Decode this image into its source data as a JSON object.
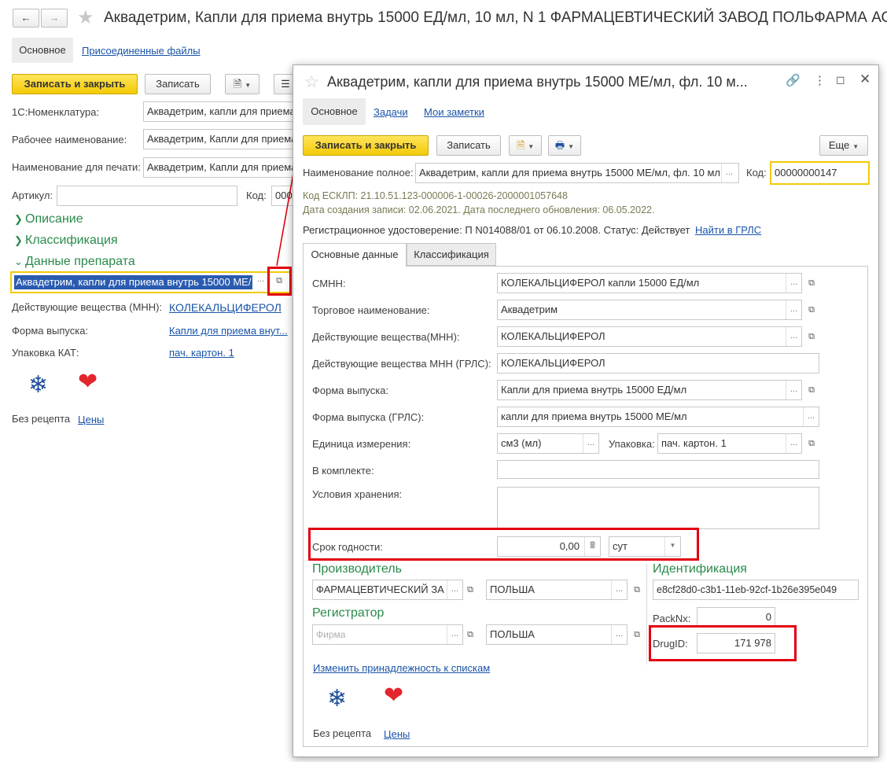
{
  "back": {
    "title": "Аквадетрим, Капли для приема внутрь 15000 ЕД/мл, 10 мл, N 1 ФАРМАЦЕВТИЧЕСКИЙ ЗАВОД ПОЛЬФАРМА АО",
    "tabs": [
      "Основное",
      "Присоединенные файлы"
    ],
    "toolbar": {
      "save_close": "Записать и закрыть",
      "save": "Записать"
    },
    "fields": {
      "nomenclature_label": "1С:Номенклатура:",
      "nomenclature_value": "Аквадетрим, капли для приема",
      "work_name_label": "Рабочее наименование:",
      "work_name_value": "Аквадетрим, Капли для приема",
      "print_name_label": "Наименование для печати:",
      "print_name_value": "Аквадетрим, Капли для приема",
      "article_label": "Артикул:",
      "article_value": "",
      "code_label": "Код:",
      "code_value": "000"
    },
    "groups": {
      "description": "Описание",
      "classification": "Классификация",
      "drug_data": "Данные препарата"
    },
    "drug_field": "Аквадетрим, капли для приема внутрь 15000 МЕ/",
    "substances_label": "Действующие вещества (МНН):",
    "substances_value": "КОЛЕКАЛЬЦИФЕРОЛ",
    "form_label": "Форма выпуска:",
    "form_value": "Капли для приема внут...",
    "pack_label": "Упаковка КАТ:",
    "pack_value": "пач. картон. 1",
    "no_rx": "Без рецепта",
    "prices": "Цены"
  },
  "dialog": {
    "title": "Аквадетрим, капли для приема внутрь 15000 МЕ/мл, фл. 10 м...",
    "tabs": [
      "Основное",
      "Задачи",
      "Мои заметки"
    ],
    "toolbar": {
      "save_close": "Записать и закрыть",
      "save": "Записать",
      "more": "Еще"
    },
    "full_name_label": "Наименование полное:",
    "full_name_value": "Аквадетрим, капли для приема внутрь 15000 МЕ/мл, фл. 10 мл",
    "code_label": "Код:",
    "code_value": "00000000147",
    "esklp": "Код ЕСКЛП: 21.10.51.123-000006-1-00026-2000001057648",
    "dates": "Дата создания записи: 02.06.2021. Дата последнего обновления: 06.05.2022.",
    "reg_cert": "Регистрационное удостоверение: П N014088/01 от 06.10.2008. Статус: Действует",
    "find_grls": "Найти в ГРЛС",
    "inner_tabs": [
      "Основные данные",
      "Классификация"
    ],
    "rows": {
      "smnn_label": "СМНН:",
      "smnn_value": "КОЛЕКАЛЬЦИФЕРОЛ капли 15000 ЕД/мл",
      "trade_label": "Торговое наименование:",
      "trade_value": "Аквадетрим",
      "subst_label": "Действующие вещества(МНН):",
      "subst_value": "КОЛЕКАЛЬЦИФЕРОЛ",
      "subst_grls_label": "Действующие вещества МНН (ГРЛС):",
      "subst_grls_value": "КОЛЕКАЛЬЦИФЕРОЛ",
      "form_label": "Форма выпуска:",
      "form_value": "Капли для приема внутрь 15000 ЕД/мл",
      "form_grls_label": "Форма выпуска (ГРЛС):",
      "form_grls_value": "капли для приема внутрь 15000 МЕ/мл",
      "unit_label": "Единица измерения:",
      "unit_value": "см3 (мл)",
      "pack_label": "Упаковка:",
      "pack_value": "пач. картон. 1",
      "kit_label": "В комплекте:",
      "storage_label": "Условия хранения:",
      "shelf_label": "Срок годности:",
      "shelf_value": "0,00",
      "shelf_unit": "сут"
    },
    "manufacturer": {
      "title": "Производитель",
      "name": "ФАРМАЦЕВТИЧЕСКИЙ ЗА",
      "country": "ПОЛЬША"
    },
    "registrar": {
      "title": "Регистратор",
      "placeholder": "Фирма",
      "country": "ПОЛЬША"
    },
    "identification": {
      "title": "Идентификация",
      "guid": "e8cf28d0-c3b1-11eb-92cf-1b26e395e049",
      "packnx_label": "PackNx:",
      "packnx_value": "0",
      "drugid_label": "DrugID:",
      "drugid_value": "171 978"
    },
    "change_lists": "Изменить принадлежность к спискам",
    "no_rx": "Без рецепта",
    "prices": "Цены"
  },
  "colors": {
    "accent_green": "#2a8a4a",
    "link": "#1a54a8",
    "highlight_red": "#e3000f",
    "primary_yellow": "#f3ca05"
  }
}
